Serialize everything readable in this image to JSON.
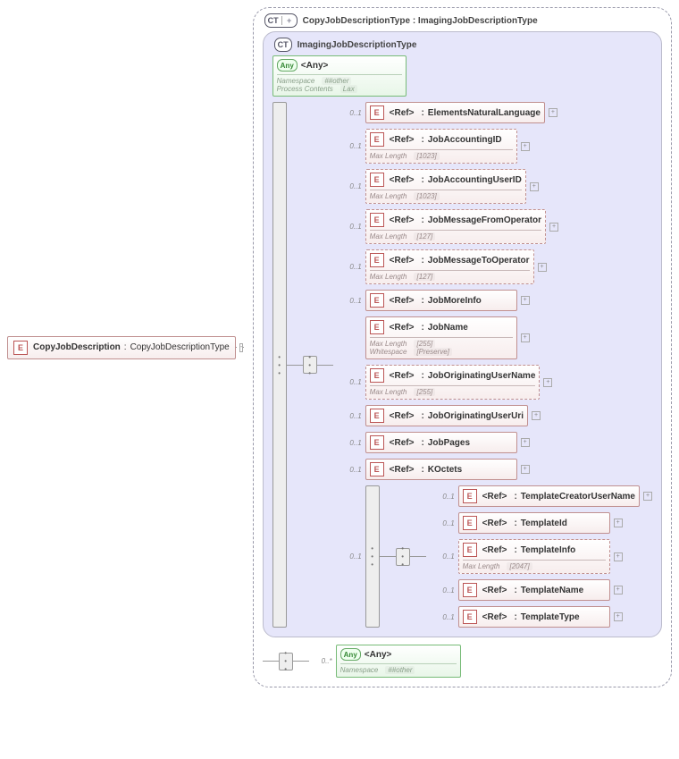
{
  "root": {
    "name": "CopyJobDescription",
    "type": "CopyJobDescriptionType"
  },
  "outer_ct": {
    "badge": "CT",
    "title": "CopyJobDescriptionType : ImagingJobDescriptionType"
  },
  "inner_ct": {
    "badge": "CT",
    "title": "ImagingJobDescriptionType"
  },
  "top_any": {
    "label": "<Any>",
    "namespace_label": "Namespace",
    "namespace_val": "##other",
    "process_label": "Process Contents",
    "process_val": "Lax"
  },
  "children": [
    {
      "card": "0..1",
      "name": "ElementsNaturalLanguage"
    },
    {
      "card": "0..1",
      "name": "JobAccountingID",
      "maxlen": "1023",
      "dashed": true
    },
    {
      "card": "0..1",
      "name": "JobAccountingUserID",
      "maxlen": "1023",
      "dashed": true
    },
    {
      "card": "0..1",
      "name": "JobMessageFromOperator",
      "maxlen": "127",
      "dashed": true
    },
    {
      "card": "0..1",
      "name": "JobMessageToOperator",
      "maxlen": "127",
      "dashed": true
    },
    {
      "card": "0..1",
      "name": "JobMoreInfo"
    },
    {
      "card": "",
      "name": "JobName",
      "maxlen": "255",
      "whitespace": "Preserve"
    },
    {
      "card": "0..1",
      "name": "JobOriginatingUserName",
      "maxlen": "255",
      "dashed": true
    },
    {
      "card": "0..1",
      "name": "JobOriginatingUserUri"
    },
    {
      "card": "0..1",
      "name": "JobPages"
    },
    {
      "card": "0..1",
      "name": "KOctets"
    }
  ],
  "subseq_card": "0..1",
  "sub_children": [
    {
      "card": "0..1",
      "name": "TemplateCreatorUserName"
    },
    {
      "card": "0..1",
      "name": "TemplateId"
    },
    {
      "card": "0..1",
      "name": "TemplateInfo",
      "maxlen": "2047",
      "dashed": true
    },
    {
      "card": "0..1",
      "name": "TemplateName"
    },
    {
      "card": "0..1",
      "name": "TemplateType"
    }
  ],
  "bottom_any": {
    "card": "0..*",
    "label": "<Any>",
    "namespace_label": "Namespace",
    "namespace_val": "##other"
  },
  "labels": {
    "ref": "<Ref>",
    "maxlen": "Max Length",
    "whitespace": "Whitespace",
    "e": "E",
    "any": "Any"
  }
}
